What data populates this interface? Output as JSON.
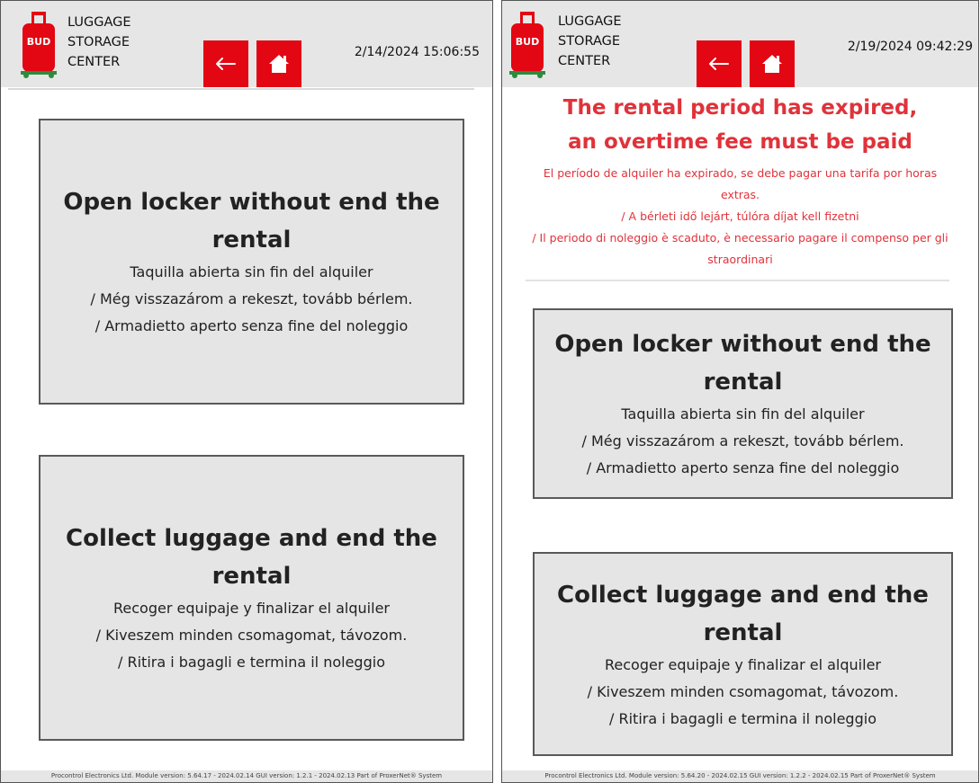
{
  "brand": {
    "logo_text": "BUD",
    "line1": "LUGGAGE",
    "line2": "STORAGE",
    "line3": "CENTER"
  },
  "colors": {
    "accent": "#e30613",
    "alert": "#e0323a",
    "header_bg": "#e6e6e6",
    "card_bg": "#e5e5e5",
    "card_border": "#595959"
  },
  "icons": {
    "back": "arrow-left-icon",
    "home": "home-icon",
    "logo": "suitcase-logo-icon"
  },
  "left": {
    "datetime": "2/14/2024 15:06:55",
    "cards": [
      {
        "title": "Open locker without end the rental",
        "lines": [
          "Taquilla abierta sin fin del alquiler",
          "/ Még visszazárom a rekeszt, tovább bérlem.",
          "/ Armadietto aperto senza fine del noleggio"
        ]
      },
      {
        "title": "Collect luggage and end the rental",
        "lines": [
          "Recoger equipaje y finalizar el alquiler",
          "/ Kiveszem minden csomagomat, távozom.",
          "/ Ritira i bagagli e termina il noleggio"
        ]
      }
    ],
    "footer": "Procontrol Electronics Ltd.  Module version: 5.64.17 - 2024.02.14 GUI version: 1.2.1 - 2024.02.13  Part of ProxerNet® System"
  },
  "right": {
    "datetime": "2/19/2024 09:42:29",
    "alert": {
      "title": "The rental period has expired, an overtime fee must be paid",
      "lines": [
        "El período de alquiler ha expirado, se debe pagar una tarifa por horas extras.",
        "/ A bérleti idő lejárt, túlóra díjat kell fizetni",
        "/ Il periodo di noleggio è scaduto, è necessario pagare il compenso per gli straordinari"
      ]
    },
    "cards": [
      {
        "title": "Open locker without end the rental",
        "lines": [
          "Taquilla abierta sin fin del alquiler",
          "/ Még visszazárom a rekeszt, tovább bérlem.",
          "/ Armadietto aperto senza fine del noleggio"
        ]
      },
      {
        "title": "Collect luggage and end the rental",
        "lines": [
          "Recoger equipaje y finalizar el alquiler",
          "/ Kiveszem minden csomagomat, távozom.",
          "/ Ritira i bagagli e termina il noleggio"
        ]
      }
    ],
    "footer": "Procontrol Electronics Ltd.  Module version: 5.64.20 - 2024.02.15 GUI version: 1.2.2 - 2024.02.15  Part of ProxerNet® System"
  }
}
